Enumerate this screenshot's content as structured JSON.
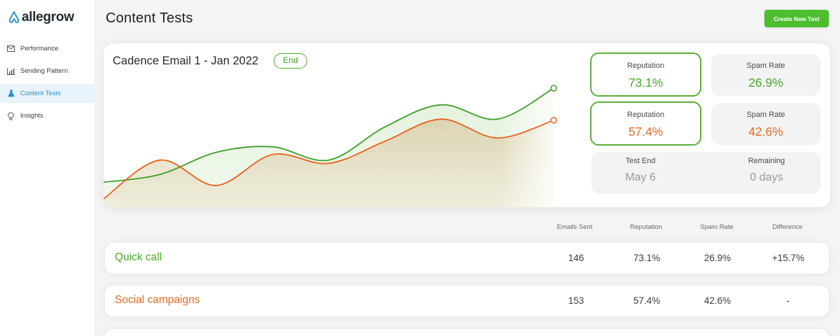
{
  "brand": {
    "name": "allegrow",
    "logo_icon": "allegrow-logo-icon"
  },
  "sidebar": {
    "items": [
      {
        "label": "Performance",
        "icon": "envelope-icon",
        "active": false
      },
      {
        "label": "Sending Pattern",
        "icon": "bar-chart-icon",
        "active": false
      },
      {
        "label": "Content Tests",
        "icon": "flask-icon",
        "active": true
      },
      {
        "label": "Insights",
        "icon": "lightbulb-icon",
        "active": false
      }
    ]
  },
  "header": {
    "title": "Content Tests",
    "create_button": "Create New Test"
  },
  "test": {
    "title": "Cadence Email 1 - Jan 2022",
    "badge": "End",
    "stats": [
      {
        "label": "Reputation",
        "value": "73.1%",
        "color": "#4ba82a"
      },
      {
        "label": "Spam Rate",
        "value": "26.9%",
        "color": "#4ba82a"
      },
      {
        "label": "Reputation",
        "value": "57.4%",
        "color": "#ec6a1f"
      },
      {
        "label": "Spam Rate",
        "value": "42.6%",
        "color": "#ec6a1f"
      }
    ],
    "test_end": {
      "label": "Test End",
      "value": "May 6"
    },
    "remaining": {
      "label": "Remaining",
      "value": "0 days"
    }
  },
  "chart_data": {
    "type": "line",
    "series": [
      {
        "name": "Quick call",
        "color": "#3f9f2b",
        "values": [
          0.15,
          0.22,
          0.42,
          0.47,
          0.35,
          0.65,
          0.85,
          0.72,
          1.0
        ]
      },
      {
        "name": "Social campaigns",
        "color": "#ec5f1c",
        "values": [
          0.0,
          0.35,
          0.12,
          0.4,
          0.32,
          0.52,
          0.72,
          0.55,
          0.71
        ]
      }
    ]
  },
  "table": {
    "headers": [
      "Emails Sent",
      "Reputation",
      "Spam Rate",
      "Difference"
    ],
    "rows": [
      {
        "name": "Quick call",
        "color": "#4ba82a",
        "cells": [
          "146",
          "73.1%",
          "26.9%",
          "+15.7%"
        ],
        "diff_color": "#4ba82a"
      },
      {
        "name": "Social campaigns",
        "color": "#ec6a1f",
        "cells": [
          "153",
          "57.4%",
          "42.6%",
          "-"
        ],
        "diff_color": "#3c3c3c"
      }
    ]
  }
}
